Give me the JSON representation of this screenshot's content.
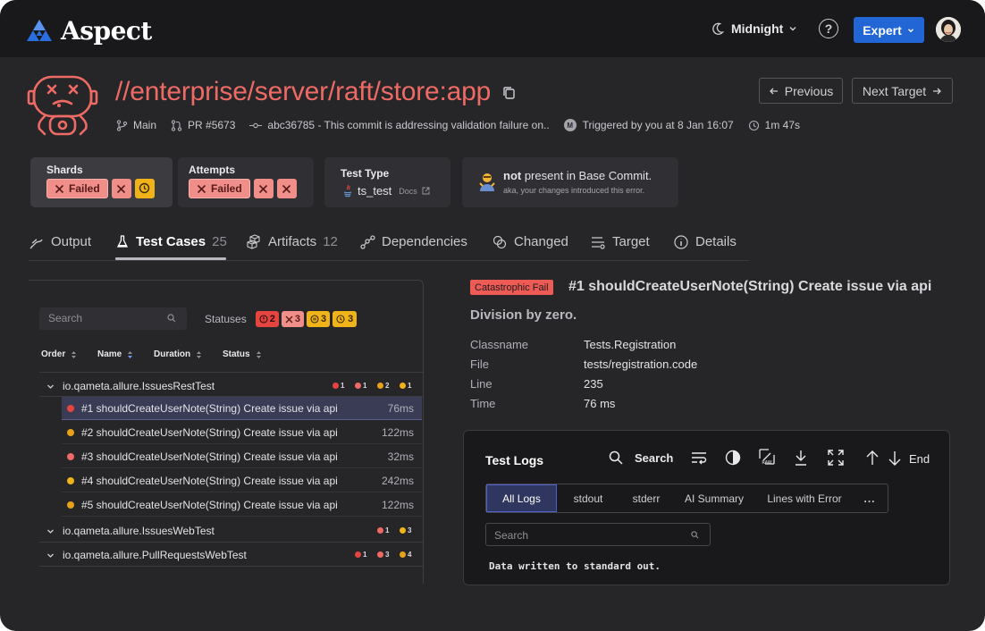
{
  "app": {
    "name": "Aspect"
  },
  "header": {
    "theme_label": "Midnight",
    "help_glyph": "?",
    "mode_label": "Expert"
  },
  "target": {
    "title": "//enterprise/server/raft/store:app",
    "prev_label": "Previous",
    "next_label": "Next Target",
    "meta": {
      "branch": "Main",
      "pr": "PR #5673",
      "commit": "abc36785 - This commit is addressing validation failure on..",
      "trigger_avatar": "M",
      "trigger": "Triggered by you at 8 Jan 16:07",
      "duration": "1m 47s"
    }
  },
  "cards": {
    "shards": {
      "label": "Shards",
      "failed": "Failed"
    },
    "attempts": {
      "label": "Attempts",
      "failed": "Failed"
    },
    "test_type": {
      "label": "Test Type",
      "value": "ts_test",
      "docs": "Docs"
    },
    "base": {
      "strong": "not",
      "text": " present in Base Commit.",
      "sub": "aka, your changes introduced this error."
    }
  },
  "tabs": [
    {
      "label": "Output",
      "count": ""
    },
    {
      "label": "Test Cases",
      "count": "25"
    },
    {
      "label": "Artifacts",
      "count": "12"
    },
    {
      "label": "Dependencies",
      "count": ""
    },
    {
      "label": "Changed",
      "count": ""
    },
    {
      "label": "Target",
      "count": ""
    },
    {
      "label": "Details",
      "count": ""
    }
  ],
  "testcases": {
    "search_placeholder": "Search",
    "statuses_label": "Statuses",
    "status_counts": {
      "error": "2",
      "failed": "3",
      "flaky": "3",
      "timeout": "3"
    },
    "columns": {
      "order": "Order",
      "name": "Name",
      "duration": "Duration",
      "status": "Status"
    },
    "groups": [
      {
        "name": "io.qameta.allure.IssuesRestTest",
        "counts": [
          "1",
          "1",
          "2",
          "1"
        ]
      },
      {
        "name": "io.qameta.allure.IssuesWebTest",
        "counts": [
          "1",
          "3"
        ]
      },
      {
        "name": "io.qameta.allure.PullRequestsWebTest",
        "counts": [
          "1",
          "3",
          "4"
        ]
      }
    ],
    "rows": [
      {
        "name": "#1 shouldCreateUserNote(String) Create issue via api",
        "duration": "76ms",
        "status": "error",
        "color": "#e5453f"
      },
      {
        "name": "#2 shouldCreateUserNote(String) Create issue via api",
        "duration": "122ms",
        "status": "flaky",
        "color": "#e8a21a"
      },
      {
        "name": "#3 shouldCreateUserNote(String) Create issue via api",
        "duration": "32ms",
        "status": "failed",
        "color": "#ee6a64"
      },
      {
        "name": "#4 shouldCreateUserNote(String) Create issue via api",
        "duration": "242ms",
        "status": "timeout",
        "color": "#f0b31a"
      },
      {
        "name": "#5 shouldCreateUserNote(String) Create issue via api",
        "duration": "122ms",
        "status": "flaky",
        "color": "#e8a21a"
      }
    ]
  },
  "detail": {
    "badge": "Catastrophic Fail",
    "title": "#1 shouldCreateUserNote(String) Create issue via api",
    "subtitle": "Division by zero.",
    "fields": [
      {
        "key": "Classname",
        "value": "Tests.Registration"
      },
      {
        "key": "File",
        "value": "tests/registration.code"
      },
      {
        "key": "Line",
        "value": "235"
      },
      {
        "key": "Time",
        "value": "76 ms"
      }
    ]
  },
  "logs": {
    "title": "Test Logs",
    "search_label": "Search",
    "end_label": "End",
    "tabs": [
      "All Logs",
      "stdout",
      "stderr",
      "AI Summary",
      "Lines with Error",
      "..."
    ],
    "search_placeholder": "Search",
    "output": "Data written to standard out."
  },
  "colors": {
    "accent": "#2266d6",
    "error": "#ee6a64",
    "warning": "#f0b31a",
    "background": "#262629"
  }
}
